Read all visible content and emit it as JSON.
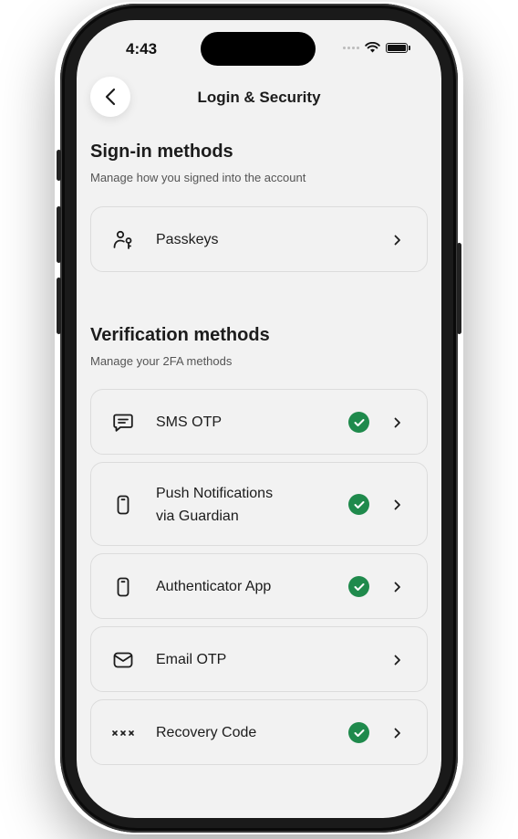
{
  "status_bar": {
    "time": "4:43"
  },
  "nav": {
    "title": "Login & Security",
    "back_icon": "chevron-left-icon"
  },
  "sign_in": {
    "title": "Sign-in methods",
    "subtitle": "Manage how you signed into the account",
    "items": [
      {
        "label": "Passkeys",
        "icon": "passkey-icon",
        "enabled": false
      }
    ]
  },
  "verification": {
    "title": "Verification methods",
    "subtitle": "Manage your 2FA methods",
    "items": [
      {
        "label": "SMS OTP",
        "icon": "message-icon",
        "enabled": true
      },
      {
        "label_line1": "Push Notifications",
        "label_line2": "via Guardian",
        "icon": "phone-icon",
        "enabled": true
      },
      {
        "label": "Authenticator App",
        "icon": "phone-icon",
        "enabled": true
      },
      {
        "label": "Email OTP",
        "icon": "mail-icon",
        "enabled": false
      },
      {
        "label": "Recovery Code",
        "icon": "asterisks-icon",
        "enabled": true
      }
    ]
  },
  "colors": {
    "check_green": "#1f8a4c",
    "background": "#f2f2f2",
    "text": "#1c1c1c"
  }
}
